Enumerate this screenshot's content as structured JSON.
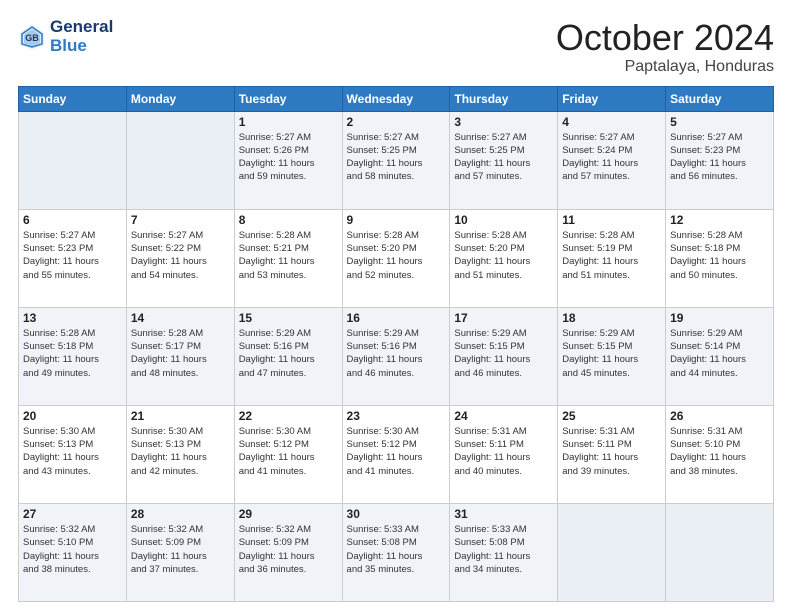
{
  "header": {
    "logo_line1": "General",
    "logo_line2": "Blue",
    "title": "October 2024",
    "subtitle": "Paptalaya, Honduras"
  },
  "days_of_week": [
    "Sunday",
    "Monday",
    "Tuesday",
    "Wednesday",
    "Thursday",
    "Friday",
    "Saturday"
  ],
  "weeks": [
    [
      {
        "day": "",
        "info": ""
      },
      {
        "day": "",
        "info": ""
      },
      {
        "day": "1",
        "info": "Sunrise: 5:27 AM\nSunset: 5:26 PM\nDaylight: 11 hours\nand 59 minutes."
      },
      {
        "day": "2",
        "info": "Sunrise: 5:27 AM\nSunset: 5:25 PM\nDaylight: 11 hours\nand 58 minutes."
      },
      {
        "day": "3",
        "info": "Sunrise: 5:27 AM\nSunset: 5:25 PM\nDaylight: 11 hours\nand 57 minutes."
      },
      {
        "day": "4",
        "info": "Sunrise: 5:27 AM\nSunset: 5:24 PM\nDaylight: 11 hours\nand 57 minutes."
      },
      {
        "day": "5",
        "info": "Sunrise: 5:27 AM\nSunset: 5:23 PM\nDaylight: 11 hours\nand 56 minutes."
      }
    ],
    [
      {
        "day": "6",
        "info": "Sunrise: 5:27 AM\nSunset: 5:23 PM\nDaylight: 11 hours\nand 55 minutes."
      },
      {
        "day": "7",
        "info": "Sunrise: 5:27 AM\nSunset: 5:22 PM\nDaylight: 11 hours\nand 54 minutes."
      },
      {
        "day": "8",
        "info": "Sunrise: 5:28 AM\nSunset: 5:21 PM\nDaylight: 11 hours\nand 53 minutes."
      },
      {
        "day": "9",
        "info": "Sunrise: 5:28 AM\nSunset: 5:20 PM\nDaylight: 11 hours\nand 52 minutes."
      },
      {
        "day": "10",
        "info": "Sunrise: 5:28 AM\nSunset: 5:20 PM\nDaylight: 11 hours\nand 51 minutes."
      },
      {
        "day": "11",
        "info": "Sunrise: 5:28 AM\nSunset: 5:19 PM\nDaylight: 11 hours\nand 51 minutes."
      },
      {
        "day": "12",
        "info": "Sunrise: 5:28 AM\nSunset: 5:18 PM\nDaylight: 11 hours\nand 50 minutes."
      }
    ],
    [
      {
        "day": "13",
        "info": "Sunrise: 5:28 AM\nSunset: 5:18 PM\nDaylight: 11 hours\nand 49 minutes."
      },
      {
        "day": "14",
        "info": "Sunrise: 5:28 AM\nSunset: 5:17 PM\nDaylight: 11 hours\nand 48 minutes."
      },
      {
        "day": "15",
        "info": "Sunrise: 5:29 AM\nSunset: 5:16 PM\nDaylight: 11 hours\nand 47 minutes."
      },
      {
        "day": "16",
        "info": "Sunrise: 5:29 AM\nSunset: 5:16 PM\nDaylight: 11 hours\nand 46 minutes."
      },
      {
        "day": "17",
        "info": "Sunrise: 5:29 AM\nSunset: 5:15 PM\nDaylight: 11 hours\nand 46 minutes."
      },
      {
        "day": "18",
        "info": "Sunrise: 5:29 AM\nSunset: 5:15 PM\nDaylight: 11 hours\nand 45 minutes."
      },
      {
        "day": "19",
        "info": "Sunrise: 5:29 AM\nSunset: 5:14 PM\nDaylight: 11 hours\nand 44 minutes."
      }
    ],
    [
      {
        "day": "20",
        "info": "Sunrise: 5:30 AM\nSunset: 5:13 PM\nDaylight: 11 hours\nand 43 minutes."
      },
      {
        "day": "21",
        "info": "Sunrise: 5:30 AM\nSunset: 5:13 PM\nDaylight: 11 hours\nand 42 minutes."
      },
      {
        "day": "22",
        "info": "Sunrise: 5:30 AM\nSunset: 5:12 PM\nDaylight: 11 hours\nand 41 minutes."
      },
      {
        "day": "23",
        "info": "Sunrise: 5:30 AM\nSunset: 5:12 PM\nDaylight: 11 hours\nand 41 minutes."
      },
      {
        "day": "24",
        "info": "Sunrise: 5:31 AM\nSunset: 5:11 PM\nDaylight: 11 hours\nand 40 minutes."
      },
      {
        "day": "25",
        "info": "Sunrise: 5:31 AM\nSunset: 5:11 PM\nDaylight: 11 hours\nand 39 minutes."
      },
      {
        "day": "26",
        "info": "Sunrise: 5:31 AM\nSunset: 5:10 PM\nDaylight: 11 hours\nand 38 minutes."
      }
    ],
    [
      {
        "day": "27",
        "info": "Sunrise: 5:32 AM\nSunset: 5:10 PM\nDaylight: 11 hours\nand 38 minutes."
      },
      {
        "day": "28",
        "info": "Sunrise: 5:32 AM\nSunset: 5:09 PM\nDaylight: 11 hours\nand 37 minutes."
      },
      {
        "day": "29",
        "info": "Sunrise: 5:32 AM\nSunset: 5:09 PM\nDaylight: 11 hours\nand 36 minutes."
      },
      {
        "day": "30",
        "info": "Sunrise: 5:33 AM\nSunset: 5:08 PM\nDaylight: 11 hours\nand 35 minutes."
      },
      {
        "day": "31",
        "info": "Sunrise: 5:33 AM\nSunset: 5:08 PM\nDaylight: 11 hours\nand 34 minutes."
      },
      {
        "day": "",
        "info": ""
      },
      {
        "day": "",
        "info": ""
      }
    ]
  ],
  "shaded_rows": [
    0,
    2,
    4
  ]
}
